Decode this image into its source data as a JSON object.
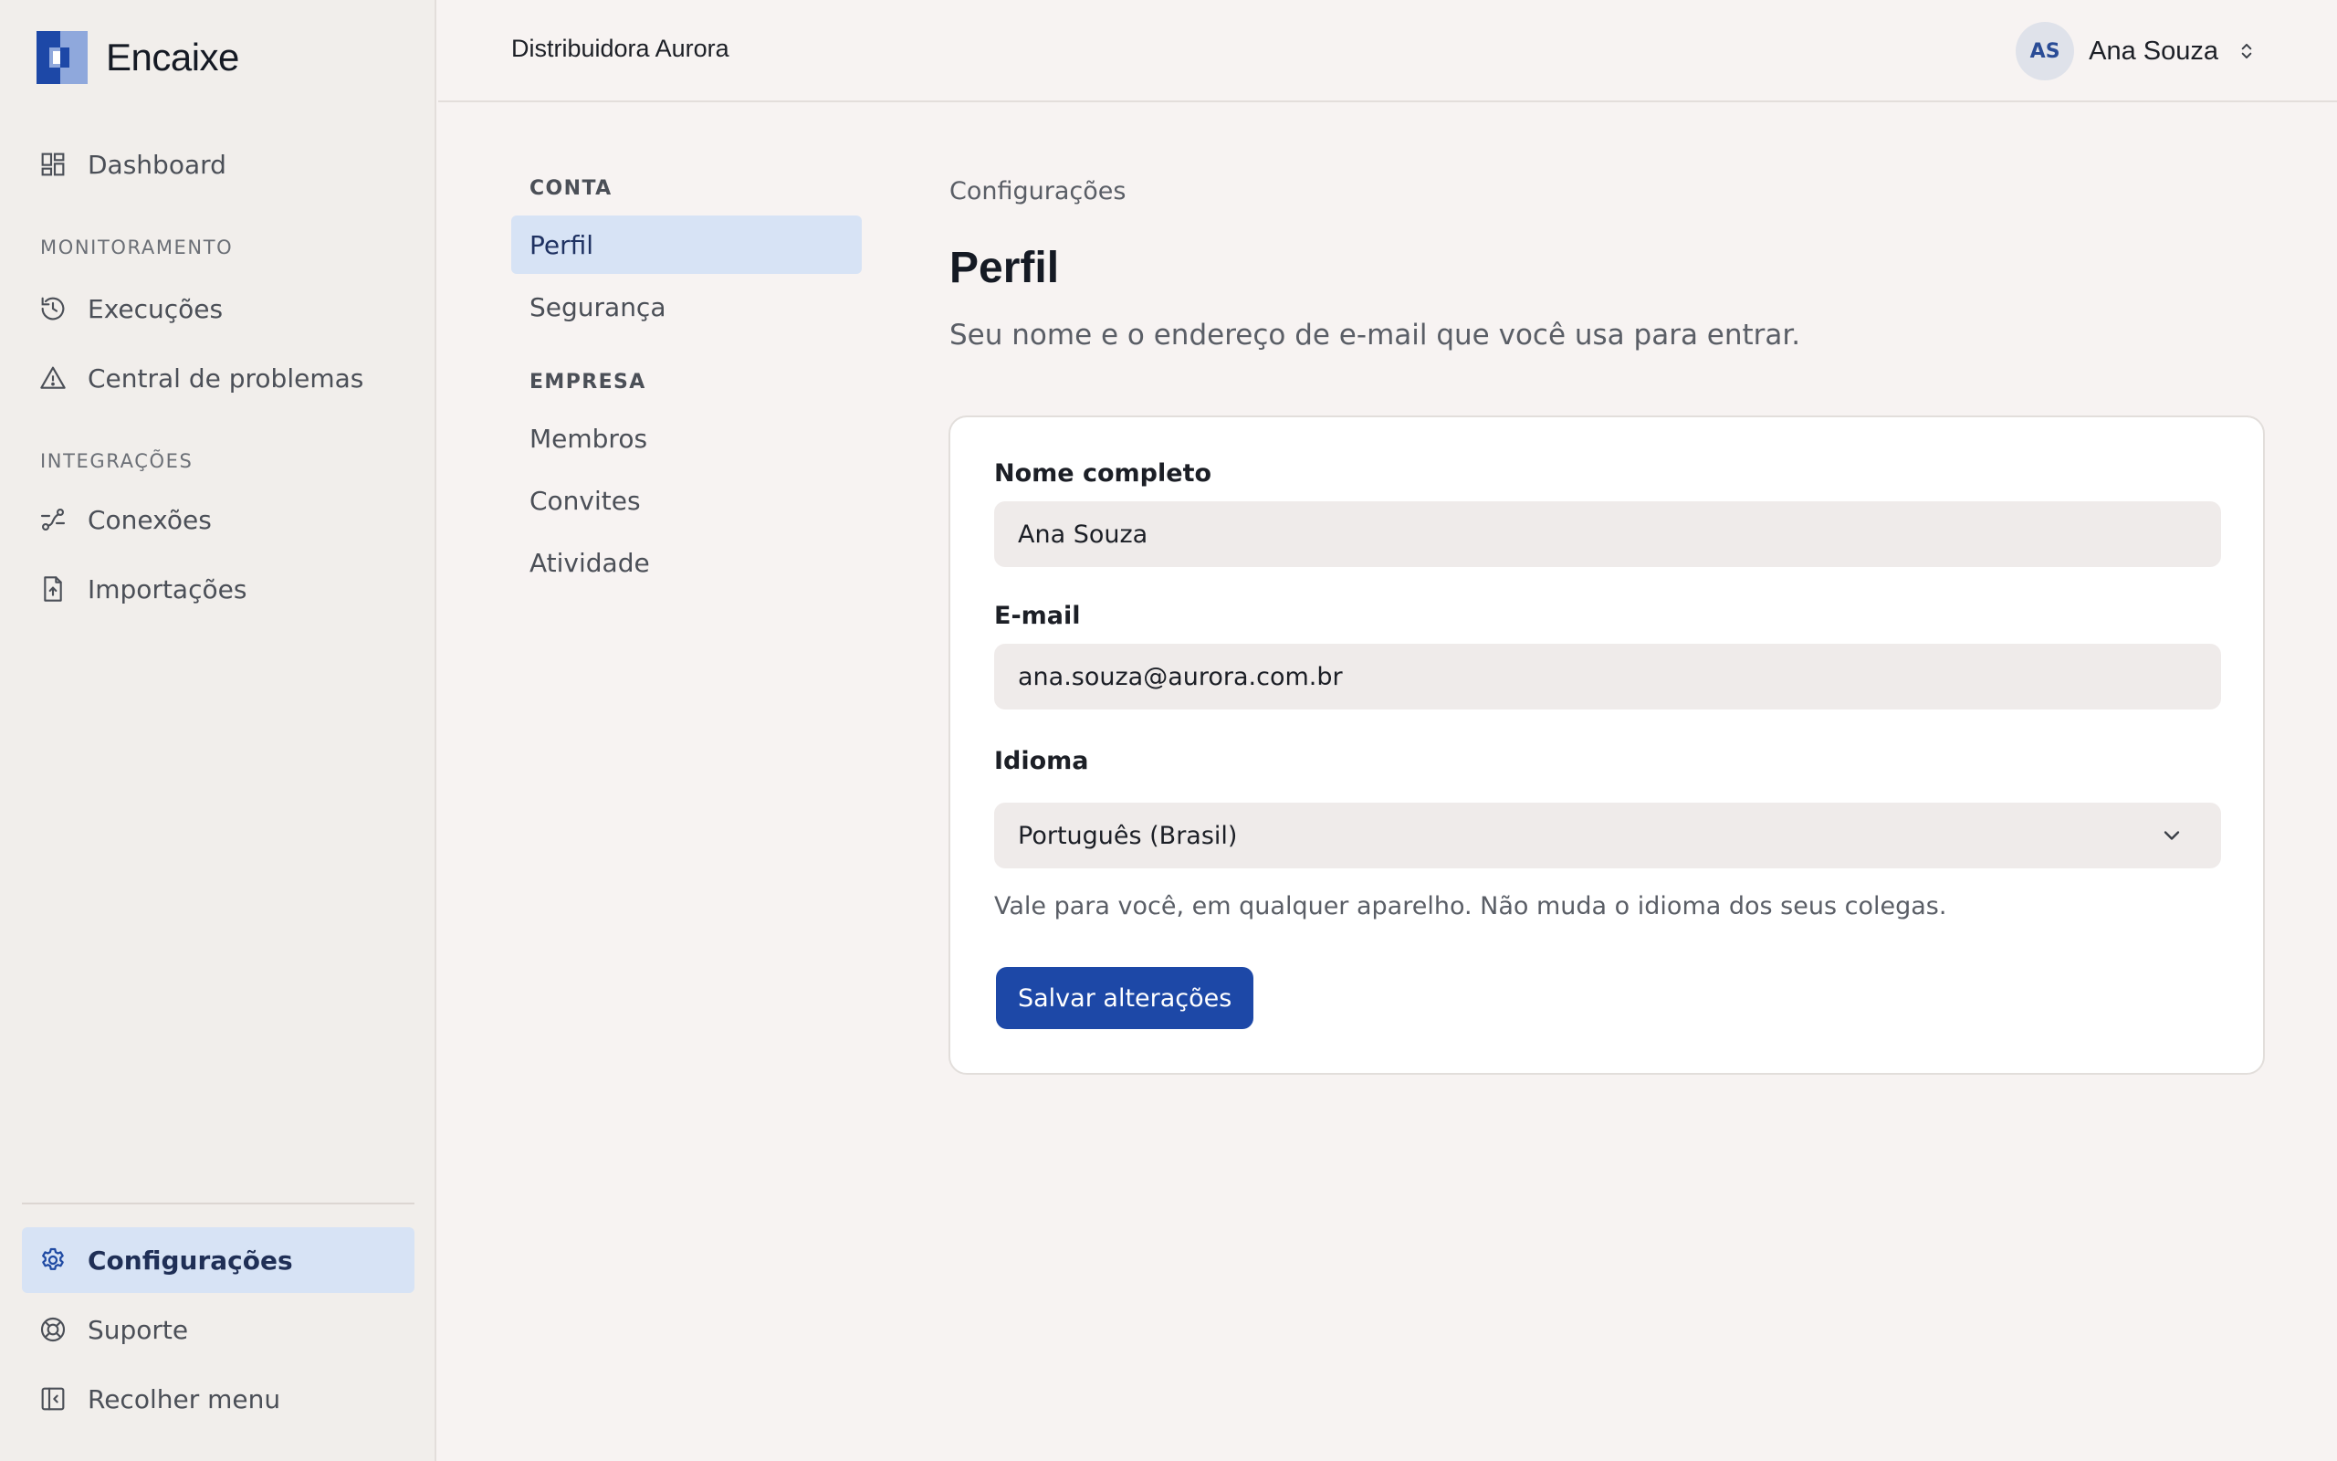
{
  "brand": {
    "name": "Encaixe",
    "colors": {
      "dark": "#1d48a7",
      "light": "#8fa8dc"
    }
  },
  "sidebar": {
    "dashboard": {
      "label": "Dashboard",
      "icon": "dashboard-icon"
    },
    "sections": [
      {
        "title": "MONITORAMENTO",
        "items": [
          {
            "label": "Execuções",
            "icon": "history-icon"
          },
          {
            "label": "Central de problemas",
            "icon": "warning-icon"
          }
        ]
      },
      {
        "title": "INTEGRAÇÕES",
        "items": [
          {
            "label": "Conexões",
            "icon": "connection-icon"
          },
          {
            "label": "Importações",
            "icon": "file-upload-icon"
          }
        ]
      }
    ],
    "bottom": [
      {
        "label": "Configurações",
        "icon": "gear-icon",
        "active": true
      },
      {
        "label": "Suporte",
        "icon": "lifebuoy-icon"
      },
      {
        "label": "Recolher menu",
        "icon": "collapse-sidebar-icon"
      }
    ]
  },
  "topbar": {
    "org": "Distribuidora Aurora",
    "user": {
      "initials": "AS",
      "name": "Ana Souza"
    }
  },
  "settings_nav": {
    "sections": [
      {
        "title": "CONTA",
        "items": [
          {
            "label": "Perfil",
            "active": true
          },
          {
            "label": "Segurança"
          }
        ]
      },
      {
        "title": "EMPRESA",
        "items": [
          {
            "label": "Membros"
          },
          {
            "label": "Convites"
          },
          {
            "label": "Atividade"
          }
        ]
      }
    ]
  },
  "main": {
    "breadcrumb": "Configurações",
    "title": "Perfil",
    "subtitle": "Seu nome e o endereço de e-mail que você usa para entrar.",
    "form": {
      "name_label": "Nome completo",
      "name_value": "Ana Souza",
      "email_label": "E-mail",
      "email_value": "ana.souza@aurora.com.br",
      "language_label": "Idioma",
      "language_value": "Português (Brasil)",
      "language_help": "Vale para você, em qualquer aparelho. Não muda o idioma dos seus colegas.",
      "save_label": "Salvar alterações"
    }
  },
  "colors": {
    "accent": "#1d48a7",
    "active_bg": "#d7e3f5"
  }
}
